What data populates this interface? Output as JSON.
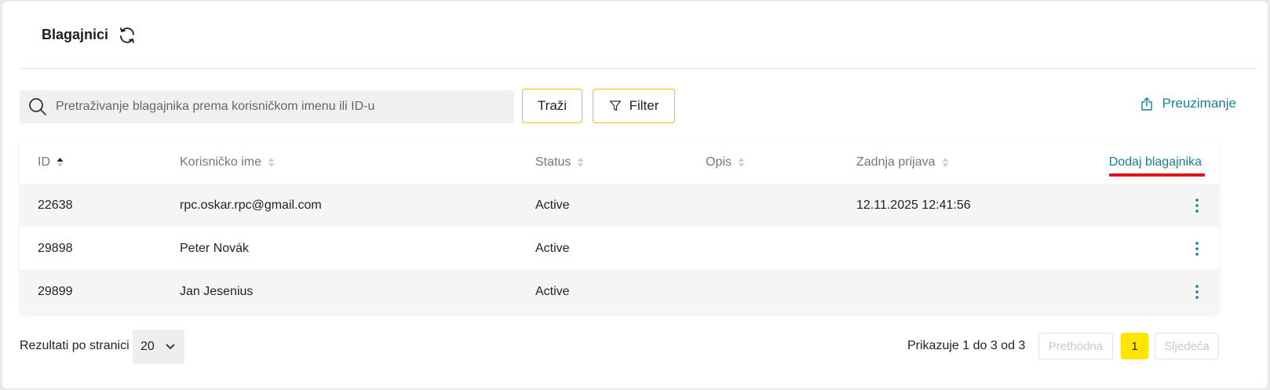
{
  "header": {
    "title": "Blagajnici",
    "refresh_icon": "refresh-icon"
  },
  "toolbar": {
    "search_placeholder": "Pretraživanje blagajnika prema korisničkom imenu ili ID-u",
    "search_value": "",
    "search_button": "Traži",
    "filter_button": "Filter",
    "download_link": "Preuzimanje"
  },
  "table": {
    "columns": [
      "ID",
      "Korisničko ime",
      "Status",
      "Opis",
      "Zadnja prijava"
    ],
    "sorted_column": "ID",
    "add_link": "Dodaj blagajnika",
    "rows": [
      {
        "id": "22638",
        "username": "rpc.oskar.rpc@gmail.com",
        "status": "Active",
        "description": "",
        "last_login": "12.11.2025 12:41:56"
      },
      {
        "id": "29898",
        "username": "Peter Novák",
        "status": "Active",
        "description": "",
        "last_login": ""
      },
      {
        "id": "29899",
        "username": "Jan Jesenius",
        "status": "Active",
        "description": "",
        "last_login": ""
      }
    ]
  },
  "footer": {
    "per_page_label": "Rezultati po stranici",
    "per_page_value": "20",
    "showing_text": "Prikazuje 1 do 3 od 3",
    "prev_label": "Prethodna",
    "current_page": "1",
    "next_label": "Sljedeća"
  },
  "colors": {
    "accent_link": "#1b7f93",
    "button_border": "#f2c200",
    "active_page": "#ffe500",
    "highlight_underline": "#e0141e"
  }
}
